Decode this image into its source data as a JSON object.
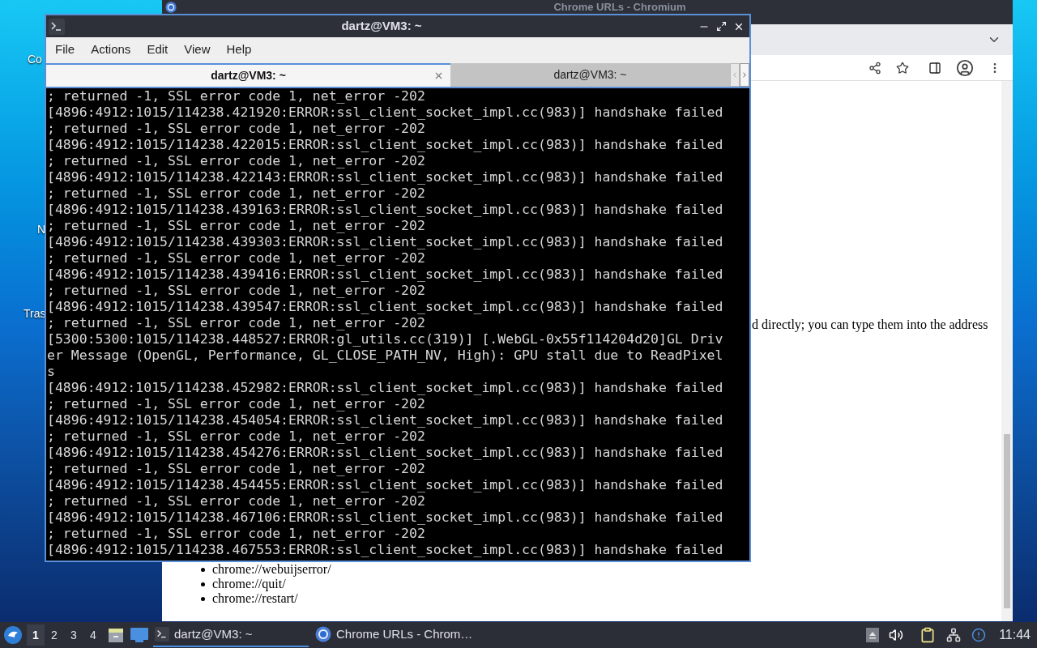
{
  "desktop": {
    "icons": [
      {
        "label": "Co"
      },
      {
        "label": "N"
      },
      {
        "label": "Tras"
      }
    ]
  },
  "browser": {
    "title": "Chrome URLs - Chromium",
    "content": {
      "paragraph": "d directly; you can type them into the address",
      "list_items": [
        "chrome://webuijserror/",
        "chrome://quit/",
        "chrome://restart/"
      ]
    }
  },
  "terminal": {
    "title": "dartz@VM3: ~",
    "menu": [
      "File",
      "Actions",
      "Edit",
      "View",
      "Help"
    ],
    "tabs": [
      {
        "label": "dartz@VM3: ~",
        "selected": true
      },
      {
        "label": "dartz@VM3: ~",
        "selected": false
      }
    ],
    "lines": [
      "; returned -1, SSL error code 1, net_error -202",
      "[4896:4912:1015/114238.421920:ERROR:ssl_client_socket_impl.cc(983)] handshake failed",
      "; returned -1, SSL error code 1, net_error -202",
      "[4896:4912:1015/114238.422015:ERROR:ssl_client_socket_impl.cc(983)] handshake failed",
      "; returned -1, SSL error code 1, net_error -202",
      "[4896:4912:1015/114238.422143:ERROR:ssl_client_socket_impl.cc(983)] handshake failed",
      "; returned -1, SSL error code 1, net_error -202",
      "[4896:4912:1015/114238.439163:ERROR:ssl_client_socket_impl.cc(983)] handshake failed",
      "; returned -1, SSL error code 1, net_error -202",
      "[4896:4912:1015/114238.439303:ERROR:ssl_client_socket_impl.cc(983)] handshake failed",
      "; returned -1, SSL error code 1, net_error -202",
      "[4896:4912:1015/114238.439416:ERROR:ssl_client_socket_impl.cc(983)] handshake failed",
      "; returned -1, SSL error code 1, net_error -202",
      "[4896:4912:1015/114238.439547:ERROR:ssl_client_socket_impl.cc(983)] handshake failed",
      "; returned -1, SSL error code 1, net_error -202",
      "[5300:5300:1015/114238.448527:ERROR:gl_utils.cc(319)] [.WebGL-0x55f114204d20]GL Driv",
      "er Message (OpenGL, Performance, GL_CLOSE_PATH_NV, High): GPU stall due to ReadPixel",
      "s",
      "[4896:4912:1015/114238.452982:ERROR:ssl_client_socket_impl.cc(983)] handshake failed",
      "; returned -1, SSL error code 1, net_error -202",
      "[4896:4912:1015/114238.454054:ERROR:ssl_client_socket_impl.cc(983)] handshake failed",
      "; returned -1, SSL error code 1, net_error -202",
      "[4896:4912:1015/114238.454276:ERROR:ssl_client_socket_impl.cc(983)] handshake failed",
      "; returned -1, SSL error code 1, net_error -202",
      "[4896:4912:1015/114238.454455:ERROR:ssl_client_socket_impl.cc(983)] handshake failed",
      "; returned -1, SSL error code 1, net_error -202",
      "[4896:4912:1015/114238.467106:ERROR:ssl_client_socket_impl.cc(983)] handshake failed",
      "; returned -1, SSL error code 1, net_error -202",
      "[4896:4912:1015/114238.467553:ERROR:ssl_client_socket_impl.cc(983)] handshake failed"
    ]
  },
  "taskbar": {
    "workspaces": [
      {
        "label": "1",
        "selected": true
      },
      {
        "label": "2",
        "selected": false
      },
      {
        "label": "3",
        "selected": false
      },
      {
        "label": "4",
        "selected": false
      }
    ],
    "tasks": [
      {
        "kind": "terminal",
        "label": "dartz@VM3: ~",
        "selected": true
      },
      {
        "kind": "browser",
        "label": "Chrome URLs - Chrom…",
        "selected": false
      }
    ],
    "clock": "11:44"
  }
}
